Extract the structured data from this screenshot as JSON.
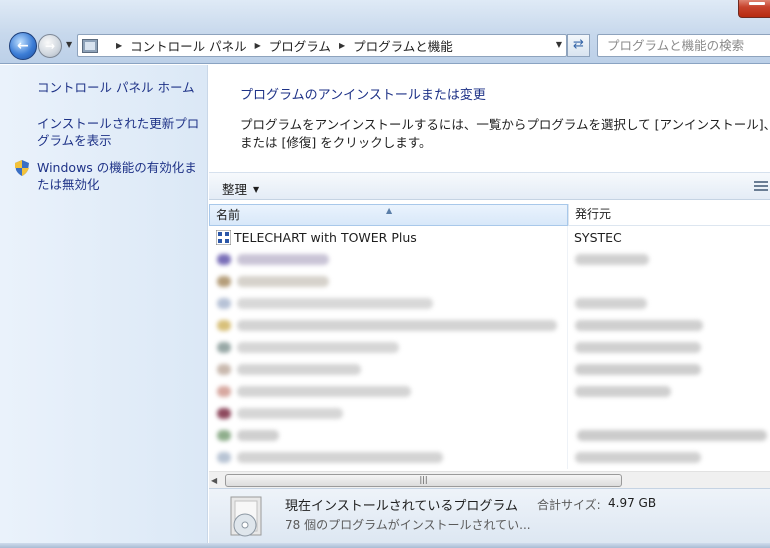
{
  "window": {
    "address": {
      "crumbs": [
        "コントロール パネル",
        "プログラム",
        "プログラムと機能"
      ]
    },
    "search_placeholder": "プログラムと機能の検索"
  },
  "sidebar": {
    "links": [
      {
        "label": "コントロール パネル ホーム"
      },
      {
        "label": "インストールされた更新プログラムを表示"
      },
      {
        "label": "Windows の機能の有効化または無効化"
      }
    ]
  },
  "main": {
    "title": "プログラムのアンインストールまたは変更",
    "description_line1": "プログラムをアンインストールするには、一覧からプログラムを選択して [アンインストール]、[変",
    "description_line2": "または [修復] をクリックします。",
    "toolbar": {
      "organize_label": "整理"
    },
    "columns": {
      "name": "名前",
      "publisher": "発行元"
    },
    "programs": [
      {
        "name": "TELECHART with TOWER Plus",
        "publisher": "SYSTEC"
      }
    ]
  },
  "details": {
    "title": "現在インストールされているプログラム",
    "size_label": "合計サイズ:",
    "size_value": "4.97 GB",
    "count_text": "78 個のプログラムがインストールされてい..."
  }
}
